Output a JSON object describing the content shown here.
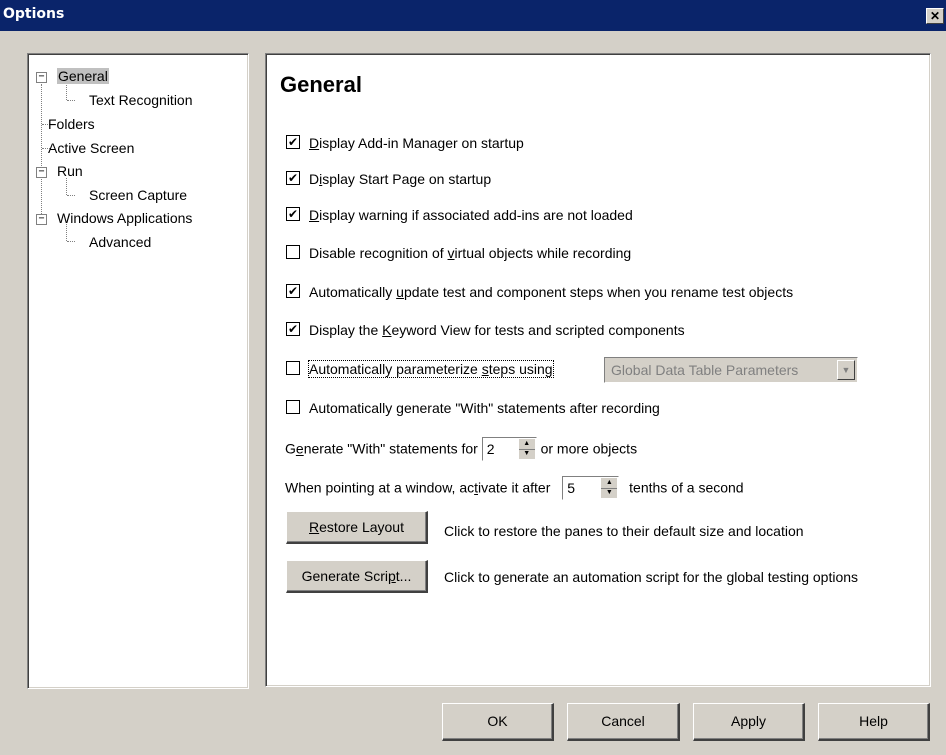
{
  "window": {
    "title": "Options",
    "close_glyph": "✕"
  },
  "tree": {
    "items": [
      {
        "label": "General",
        "expander": "−"
      },
      {
        "label": "Text Recognition"
      },
      {
        "label": "Folders"
      },
      {
        "label": "Active Screen"
      },
      {
        "label": "Run",
        "expander": "−"
      },
      {
        "label": "Screen Capture"
      },
      {
        "label": "Windows Applications",
        "expander": "−"
      },
      {
        "label": "Advanced"
      }
    ]
  },
  "panel": {
    "heading": "General",
    "options": [
      {
        "pre": "",
        "key": "D",
        "post": "isplay Add-in Manager on startup",
        "checked": true
      },
      {
        "pre": "D",
        "key": "i",
        "post": "splay Start Page on startup",
        "checked": true
      },
      {
        "pre": "",
        "key": "D",
        "post": "isplay warning if associated add-ins are not loaded",
        "checked": true
      },
      {
        "pre": "Disable recognition of ",
        "key": "v",
        "post": "irtual objects while recording",
        "checked": false
      },
      {
        "pre": "Automatically ",
        "key": "u",
        "post": "pdate test and component steps when you rename test objects",
        "checked": true
      },
      {
        "pre": "Display the ",
        "key": "K",
        "post": "eyword View for tests and scripted components",
        "checked": true
      },
      {
        "pre": "Automatically parameterize ",
        "key": "s",
        "post": "teps using",
        "checked": false
      },
      {
        "pre": "Automatically ",
        "key": "g",
        "post": "enerate \"With\" statements after recording",
        "checked": false
      }
    ],
    "param_combo": {
      "value": "Global Data Table Parameters"
    },
    "with_stmt": {
      "pre": "G",
      "key": "e",
      "post": "nerate \"With\" statements for",
      "value": "2",
      "suffix": "or more objects"
    },
    "activate": {
      "pre": "When pointing at a window, ac",
      "key": "t",
      "post": "ivate it after",
      "value": "5",
      "suffix": "tenths of a second"
    },
    "restore_btn": {
      "key": "R",
      "post": "estore Layout",
      "desc": "Click to restore the panes to their default size and location"
    },
    "script_btn": {
      "pre": "Generate Scri",
      "key": "p",
      "post": "t...",
      "desc": "Click to generate an automation script for the global testing options"
    }
  },
  "buttons": {
    "ok": "OK",
    "cancel": "Cancel",
    "apply": "Apply",
    "help": "Help"
  },
  "icons": {
    "check": "✔",
    "spin_up": "▲",
    "spin_down": "▼",
    "combo_arrow": "▼"
  }
}
